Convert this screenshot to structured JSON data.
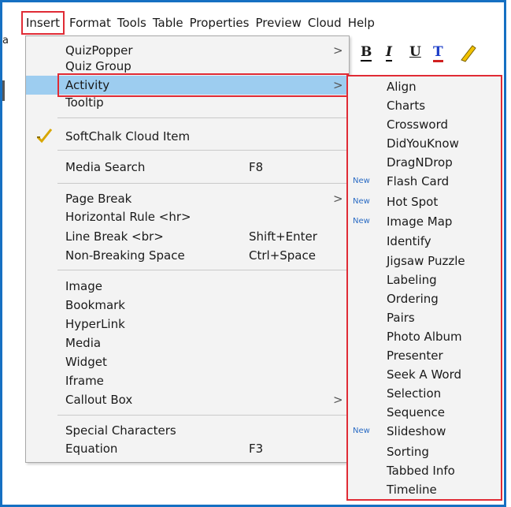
{
  "menubar": [
    "Insert",
    "Format",
    "Tools",
    "Table",
    "Properties",
    "Preview",
    "Cloud",
    "Help"
  ],
  "stray_char": "a",
  "toolbar": {
    "bold": "B",
    "italic": "I",
    "underline": "U",
    "text_color": "T"
  },
  "menu": [
    {
      "label": "QuizPopper",
      "arrow": ">"
    },
    {
      "label": "Quiz Group"
    },
    {
      "label": "Activity",
      "arrow": ">"
    },
    {
      "label": "Tooltip"
    },
    {
      "label": "SoftChalk Cloud Item"
    },
    {
      "label": "Media Search",
      "shortcut": "F8"
    },
    {
      "label": "Page Break",
      "arrow": ">"
    },
    {
      "label": "Horizontal Rule <hr>"
    },
    {
      "label": "Line Break <br>",
      "shortcut": "Shift+Enter"
    },
    {
      "label": "Non-Breaking Space",
      "shortcut": "Ctrl+Space"
    },
    {
      "label": "Image"
    },
    {
      "label": "Bookmark"
    },
    {
      "label": "HyperLink"
    },
    {
      "label": "Media"
    },
    {
      "label": "Widget"
    },
    {
      "label": "Iframe"
    },
    {
      "label": "Callout Box",
      "arrow": ">"
    },
    {
      "label": "Special Characters"
    },
    {
      "label": "Equation",
      "shortcut": "F3"
    }
  ],
  "submenu": [
    {
      "label": "Align"
    },
    {
      "label": "Charts"
    },
    {
      "label": "Crossword"
    },
    {
      "label": "DidYouKnow"
    },
    {
      "label": "DragNDrop"
    },
    {
      "label": "Flash Card",
      "badge": "New"
    },
    {
      "label": "Hot Spot",
      "badge": "New"
    },
    {
      "label": "Image Map",
      "badge": "New"
    },
    {
      "label": "Identify"
    },
    {
      "label": "Jigsaw Puzzle"
    },
    {
      "label": "Labeling"
    },
    {
      "label": "Ordering"
    },
    {
      "label": "Pairs"
    },
    {
      "label": "Photo Album"
    },
    {
      "label": "Presenter"
    },
    {
      "label": "Seek A Word"
    },
    {
      "label": "Selection"
    },
    {
      "label": "Sequence"
    },
    {
      "label": "Slideshow",
      "badge": "New"
    },
    {
      "label": "Sorting"
    },
    {
      "label": "Tabbed Info"
    },
    {
      "label": "Timeline"
    }
  ],
  "colors": {
    "frame": "#1670c2",
    "highlight": "#e02b35",
    "active_row": "#9dcdf0"
  }
}
